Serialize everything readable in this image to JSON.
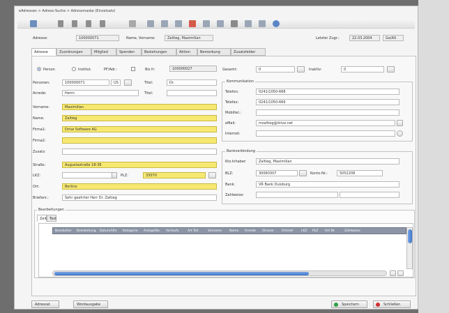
{
  "breadcrumb": "eAdressen > Adress-Suche > Adressmaske (Einzelsatz)",
  "header": {
    "adresse_label": "Adresse:",
    "adresse_value": "100000071",
    "name_label": "Name, Vorname:",
    "name_value": "Zaltieg, Maximilian",
    "letzter_label": "Letzter Zugr.:",
    "letzter_date": "22.03.2004",
    "letzter_user": "Go/AS"
  },
  "tabs": [
    "Adresse",
    "Zuordnungen",
    "Mitglied",
    "Spenden",
    "Beziehungen",
    "Aktion",
    "Bemerkung",
    "Zusatzfelder"
  ],
  "left": {
    "radio_person": "Person",
    "radio_institution": "Institut.",
    "pf_label": "PF/Adr.:",
    "bis_label": "Bis fr:",
    "bis_value": "100000027",
    "fields": [
      {
        "label": "Personen:",
        "value": "100000071"
      },
      {
        "label": "Anrede:",
        "value": "Herrn"
      },
      {
        "label": "Vorname:",
        "value": "Maximilian"
      },
      {
        "label": "Name:",
        "value": "Zaltieg"
      },
      {
        "label": "Firma1:",
        "value": "Drive Software AG"
      },
      {
        "label": "Firma2:",
        "value": ""
      },
      {
        "label": "Zusatz:",
        "value": ""
      },
      {
        "label": "Straße:",
        "value": "Augustastraße 18-36"
      },
      {
        "label": "LKZ:",
        "value": ""
      },
      {
        "label": "Ort:",
        "value": "Berlino"
      },
      {
        "label": "Briefanr.:",
        "value": "Sehr geehrter Herr Dr. Zaltieg"
      }
    ],
    "titel_label": "Titel:",
    "titel_value": "Dr.",
    "titel2_label": "Titel:",
    "titel2_value": "",
    "sub_value": "US",
    "plz_label": "PLZ:",
    "plz_value": "33070"
  },
  "right": {
    "gesamt_label": "Gesamt:",
    "gesamt_value": "0",
    "aktuell_label": "Inaktiv:",
    "aktuell_value": "0",
    "komm_title": "Kommunikation",
    "komm": [
      {
        "label": "Telefon:",
        "value": "0241/1050-668"
      },
      {
        "label": "Telefax:",
        "value": "0241/1050-669"
      },
      {
        "label": "Mobiltel.:",
        "value": ""
      },
      {
        "label": "eMail:",
        "value": "mzaltieg@drive.net"
      },
      {
        "label": "Internet:",
        "value": ""
      }
    ],
    "bank_title": "Bankverbindung",
    "kontoinhaber_label": "Kto.Inhaber:",
    "kontoinhaber_value": "Zaltieg, Maximilian",
    "blz_label": "BLZ:",
    "blz_value": "30060307",
    "konto_label": "Konto-Nr.:",
    "konto_value": "5052208",
    "bank_label": "Bank:",
    "bank_value": "VR Bank Duisburg",
    "zahlweise_label": "Zahlweise:",
    "zahlweise_value": ""
  },
  "grid": {
    "title": "Bearbeitungen",
    "subtabs": [
      "Zeit",
      "Text"
    ],
    "columns": [
      "Bearbeiter",
      "Bearbeitung",
      "Datum/Uhr.",
      "Kategorie",
      "Anlage/Be.",
      "Vorlaufz.",
      "Art Teil.",
      "Vorname",
      "Name",
      "Anrede",
      "Strasse",
      "Ortsteil",
      "LKZ",
      "PLZ",
      "Ort Nr.",
      "Zahlweise"
    ]
  },
  "footer": {
    "adressat": "Adressat",
    "wordausgabe": "Wordausgabe",
    "speichern": "Speichern",
    "schliessen": "Schließen"
  },
  "colors": {
    "highlight": "#f7e872",
    "grid_header": "#8b95a6",
    "scroll": "#3f74c9",
    "save": "#2ea043",
    "close": "#d03030"
  }
}
